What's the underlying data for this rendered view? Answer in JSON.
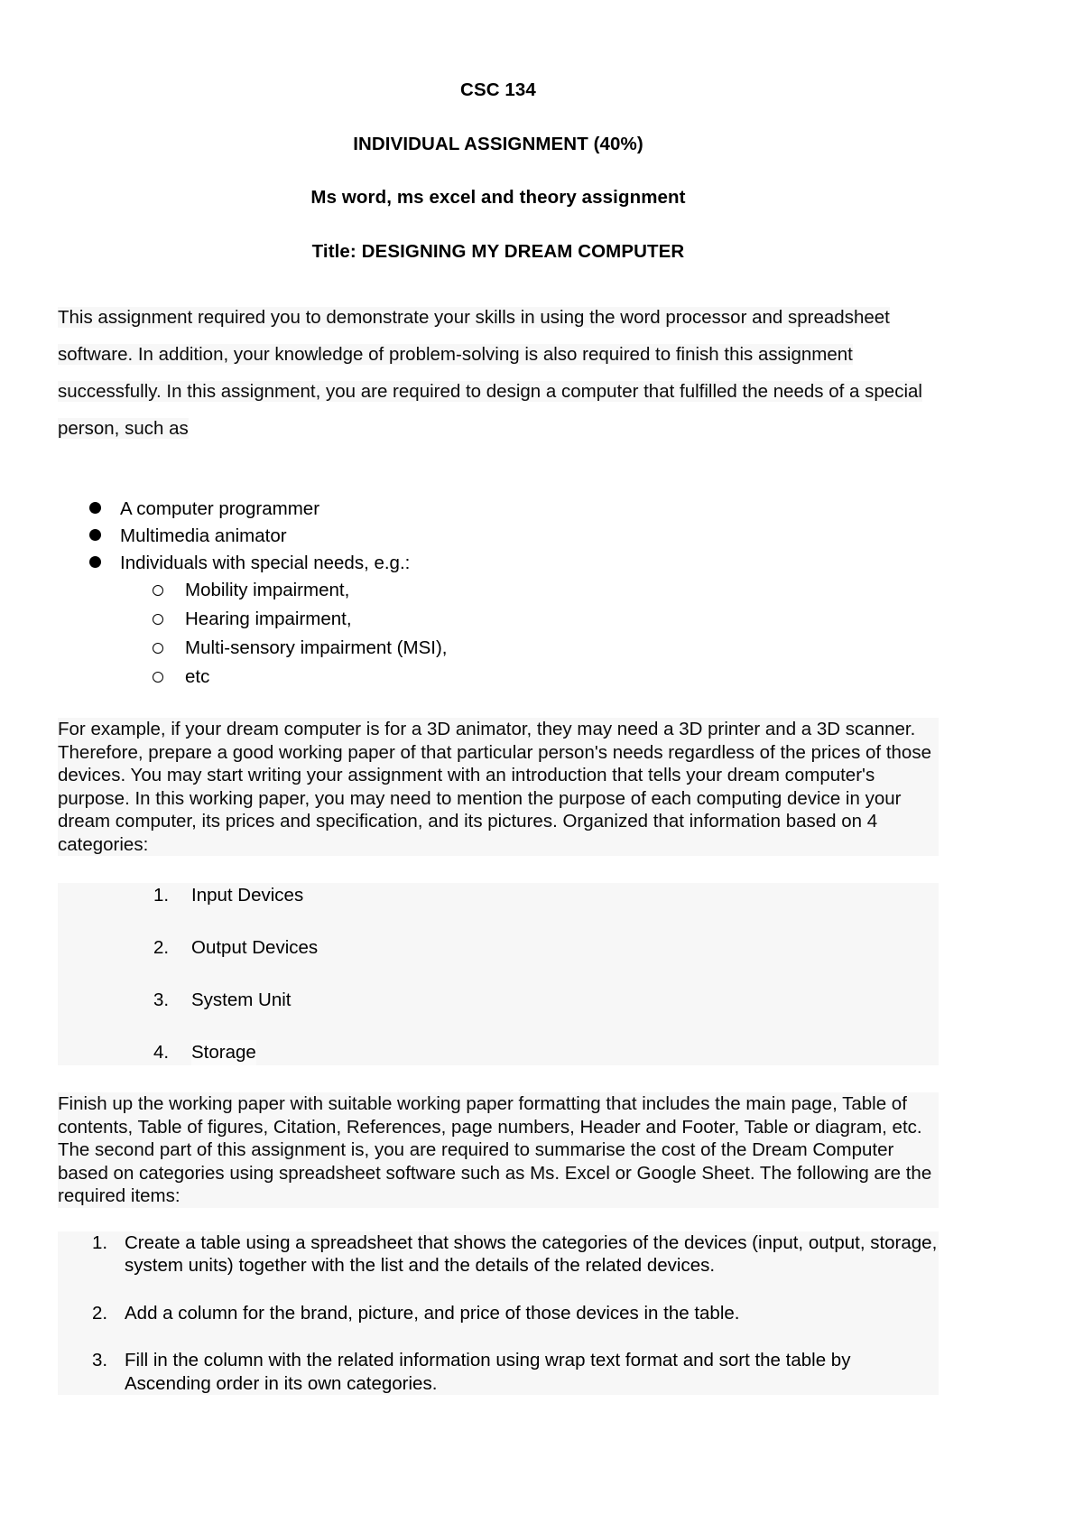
{
  "document": {
    "headings": {
      "course_code": "CSC 134",
      "assignment": "INDIVIDUAL ASSIGNMENT (40%)",
      "subtitle": "Ms word, ms excel and theory assignment",
      "title_label": "Title",
      "title_separator": ": ",
      "title_value": "DESIGNING MY DREAM COMPUTER"
    },
    "intro_paragraph": "This assignment required you to demonstrate your skills in using the word processor and spreadsheet software. In addition, your knowledge of problem-solving is also required to finish this assignment successfully. In this assignment, you are required to design a computer that fulfilled the needs of a special person, such as",
    "bullet_list": [
      {
        "marker": "filled-circle",
        "text": "A computer programmer"
      },
      {
        "marker": "filled-circle",
        "text": "Multimedia animator"
      },
      {
        "marker": "filled-circle",
        "text": "Individuals with special needs, e.g.:"
      }
    ],
    "sub_bullet_list": [
      {
        "marker": "hollow-circle",
        "text": "Mobility impairment,"
      },
      {
        "marker": "hollow-circle",
        "text": "Hearing impairment,"
      },
      {
        "marker": "hollow-circle",
        "text": "Multi-sensory impairment (MSI),"
      },
      {
        "marker": "hollow-circle",
        "text": "etc"
      }
    ],
    "example_paragraph": "For example, if your dream computer is for a 3D animator, they may need a 3D printer and a 3D scanner. Therefore, prepare a good working paper of that particular person's needs regardless of the prices of those devices. You may start writing your assignment with an introduction that tells your dream computer's purpose. In this working paper, you may need to mention the purpose of each computing device in your dream computer, its prices and specification, and its pictures. Organized that information based on 4 categories:",
    "category_list": [
      {
        "number": "1.",
        "text": "Input Devices"
      },
      {
        "number": "2.",
        "text": "Output Devices"
      },
      {
        "number": "3.",
        "text": "System Unit"
      },
      {
        "number": "4.",
        "text": "Storage"
      }
    ],
    "finish_paragraph": "Finish up the working paper with suitable working paper formatting that includes the main page, Table of contents, Table of figures, Citation, References, page numbers, Header and Footer, Table or diagram, etc. The second part of this assignment is,  you are required to summarise the cost of the Dream Computer based on categories using spreadsheet software such as Ms. Excel or Google Sheet. The following are the required items:",
    "required_items": [
      {
        "number": "1.",
        "text": "Create a table using a spreadsheet that shows the categories of the devices (input, output, storage, system units) together with the list and the details of the related devices."
      },
      {
        "number": "2.",
        "text": "Add a column for the brand, picture, and price of those devices in the table."
      },
      {
        "number": "3.",
        "text": "Fill in the column with the related information using wrap text format and sort the table by Ascending order in its own categories."
      }
    ]
  }
}
